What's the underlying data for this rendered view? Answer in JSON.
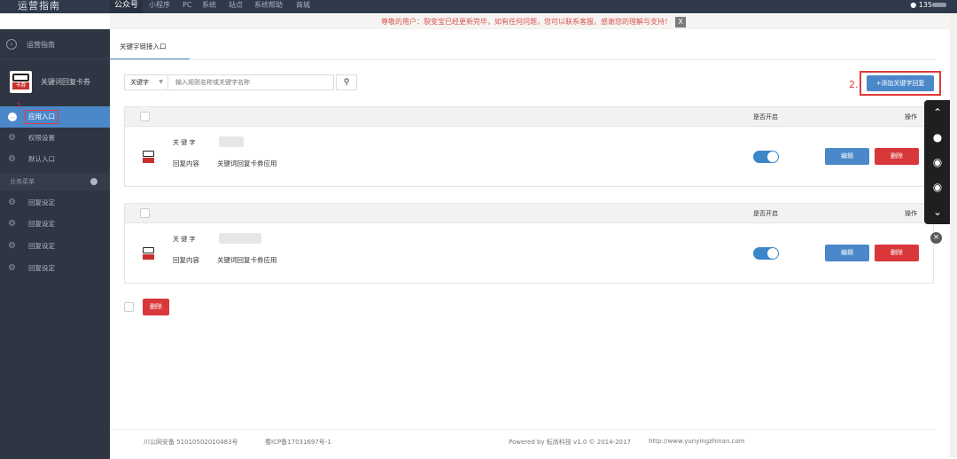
{
  "topbar": {
    "logo": "运营指南",
    "nav": [
      "公众号",
      "小程序",
      "PC",
      "系统",
      "站点",
      "系统帮助",
      "商城"
    ],
    "user": "135"
  },
  "notice": {
    "text": "尊敬的用户：裂变宝已经更新完毕，如有任何问题，您可以联系客服，感谢您的理解与支持！",
    "close": "X"
  },
  "sidebar": {
    "back_label": "运营指南",
    "app_name": "关键词回复卡券",
    "app_icon_text": "卡券",
    "items": [
      {
        "label": "应用入口"
      },
      {
        "label": "权限设置"
      },
      {
        "label": "默认入口"
      }
    ],
    "annotation": "1",
    "group_label": "业务菜单",
    "group_items": [
      {
        "label": "回复设定"
      },
      {
        "label": "回复设定"
      },
      {
        "label": "回复设定"
      },
      {
        "label": "回复设定"
      }
    ]
  },
  "tab": {
    "label": "关键字链接入口"
  },
  "search": {
    "select_value": "关键字",
    "placeholder": "输入规则名称或关键字名称"
  },
  "add": {
    "annotation": "2.",
    "label": "+添加关键字回复"
  },
  "table": {
    "header_enabled": "是否开启",
    "header_action": "操作",
    "keyword_label": "关 键 字",
    "reply_label": "回复内容",
    "rows": [
      {
        "reply_value": "关键词回复卡券应用",
        "enabled": true,
        "edit": "编辑",
        "delete": "删除"
      },
      {
        "reply_value": "关键词回复卡券应用",
        "enabled": true,
        "edit": "编辑",
        "delete": "删除"
      }
    ]
  },
  "bulk": {
    "delete_label": "删除"
  },
  "footer": {
    "police": "川公网安备 51010502010483号",
    "icp": "蜀ICP备17031697号-1",
    "powered": "Powered by 耘尚科技 v1.0 © 2014-2017",
    "url": "http://www.yunyingzhinan.com"
  },
  "colors": {
    "accent": "#4b88c9",
    "danger": "#d9383b",
    "sidebar": "#2f3542",
    "topbar": "#2e3a4b"
  }
}
